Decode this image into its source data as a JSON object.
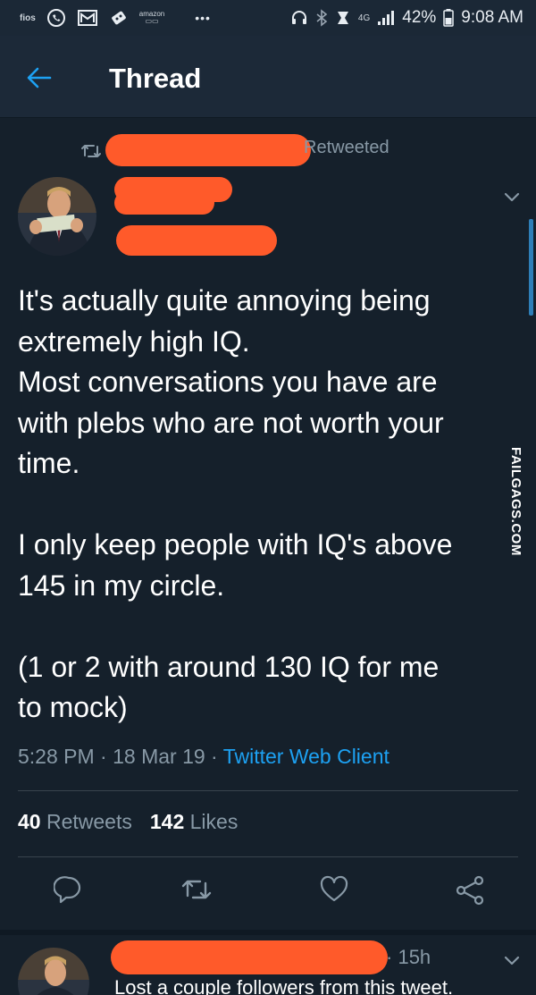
{
  "status_bar": {
    "carrier": "fios",
    "amazon": "amazon",
    "more": "•••",
    "network": "4G",
    "battery": "42%",
    "time": "9:08 AM"
  },
  "header": {
    "title": "Thread",
    "back_icon": "arrow-left-icon"
  },
  "tweet": {
    "retweeted_label": "Retweeted",
    "lines_1": [
      "It's actually quite annoying being",
      "extremely high IQ.",
      "Most conversations you have are",
      "with plebs who are not worth your",
      "time."
    ],
    "lines_2": [
      "I only keep people with IQ's above",
      "145 in my circle."
    ],
    "lines_3": [
      "(1 or 2 with around 130 IQ for me",
      "to mock)"
    ],
    "time": "5:28 PM",
    "date": "18 Mar 19",
    "client": "Twitter Web Client",
    "retweets_count": "40",
    "retweets_label": "Retweets",
    "likes_count": "142",
    "likes_label": "Likes"
  },
  "watermark": "FAILGAGS.COM",
  "reply": {
    "time": "15h",
    "text": "Lost a couple followers from this tweet."
  },
  "colors": {
    "background": "#15202b",
    "header": "#1c2938",
    "accent": "#1da1f2",
    "muted": "#8899a6",
    "redaction": "#ff5a2a"
  }
}
